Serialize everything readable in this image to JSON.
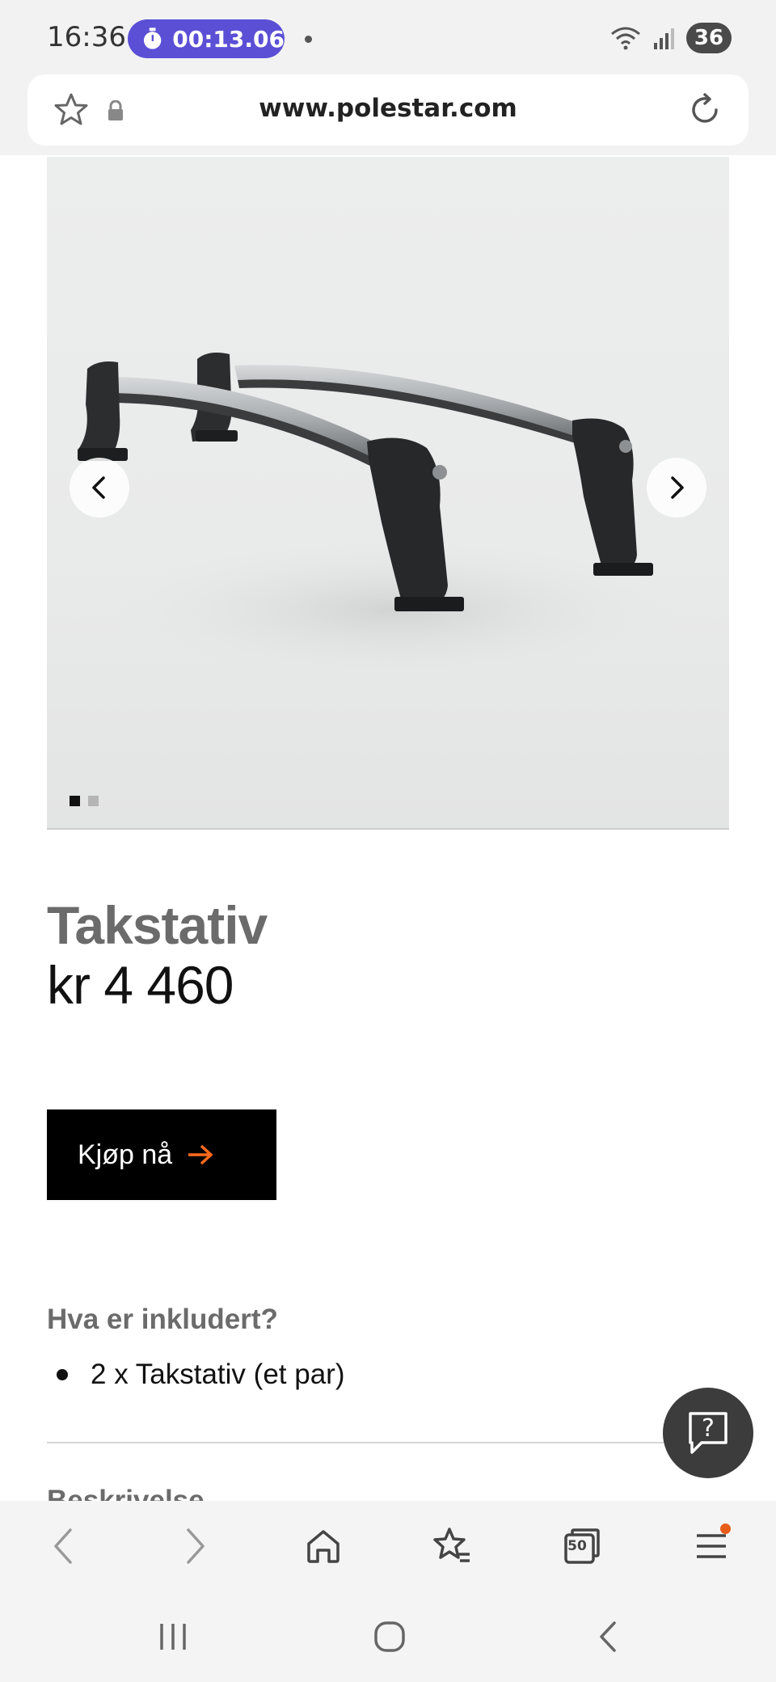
{
  "status_bar": {
    "time": "16:36",
    "timer": "00:13.06",
    "battery": "36"
  },
  "browser": {
    "url": "www.polestar.com"
  },
  "gallery": {
    "image_description": "Roof rack bars",
    "active_dot_color": "#111111",
    "inactive_dot_color": "#b5b5b5"
  },
  "product": {
    "title": "Takstativ",
    "price": "kr 4 460",
    "buy_label": "Kjøp nå",
    "buy_arrow_color": "#ff6a1a"
  },
  "included": {
    "heading": "Hva er inkludert?",
    "items": [
      "2 x Takstativ (et par)"
    ]
  },
  "description": {
    "heading": "Beskrivelse"
  },
  "toolbar": {
    "tabs_count": "50"
  }
}
